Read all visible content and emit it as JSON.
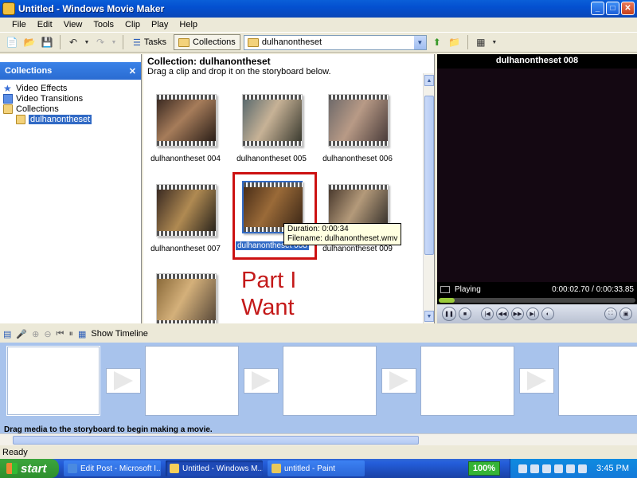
{
  "window": {
    "title": "Untitled - Windows Movie Maker"
  },
  "menu": [
    "File",
    "Edit",
    "View",
    "Tools",
    "Clip",
    "Play",
    "Help"
  ],
  "toolbar": {
    "tasks_label": "Tasks",
    "collections_label": "Collections",
    "collection_select": "dulhanontheset"
  },
  "collections_pane": {
    "title": "Collections",
    "items": [
      "Video Effects",
      "Video Transitions",
      "Collections",
      "dulhanontheset"
    ]
  },
  "collection": {
    "title": "Collection: dulhanontheset",
    "instructions": "Drag a clip and drop it on the storyboard below.",
    "clips": [
      "dulhanontheset 004",
      "dulhanontheset 005",
      "dulhanontheset 006",
      "dulhanontheset 007",
      "dulhanontheset 008",
      "dulhanontheset 009",
      ""
    ],
    "selected_clip": "dulhanontheset 008",
    "tooltip": {
      "duration": "Duration: 0:00:34",
      "filename": "Filename: dulhanontheset.wmv"
    },
    "annotation": [
      "Part I",
      "Want"
    ]
  },
  "monitor": {
    "title": "dulhanontheset 008",
    "status": "Playing",
    "time": "0:00:02.70 / 0:00:33.85",
    "progress_fraction": 0.08
  },
  "storyboard": {
    "show_timeline_label": "Show Timeline",
    "hint": "Drag media to the storyboard to begin making a movie."
  },
  "status_bar": {
    "text": "Ready"
  },
  "taskbar": {
    "start_label": "start",
    "tasks": [
      "Edit Post - Microsoft I...",
      "Untitled - Windows M...",
      "untitled - Paint"
    ],
    "zoom": "100%",
    "clock": "3:45 PM"
  },
  "colors": {
    "annotation": "#c41a1a",
    "selection": "#316ac5",
    "storyboard_bg": "#a8c3ec"
  }
}
